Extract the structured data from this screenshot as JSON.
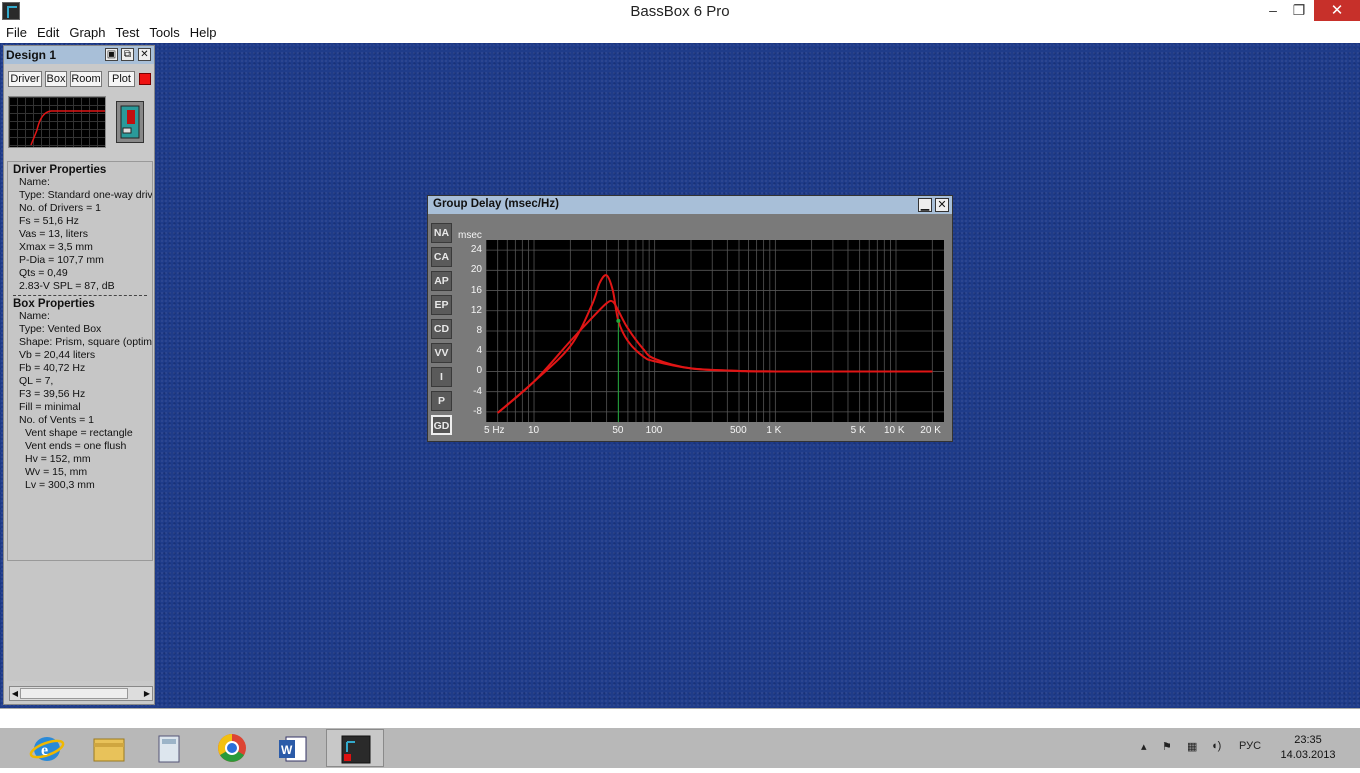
{
  "window": {
    "title": "BassBox 6 Pro",
    "min_label": "–",
    "max_label": "❐",
    "close_label": "✕"
  },
  "menu": [
    "File",
    "Edit",
    "Graph",
    "Test",
    "Tools",
    "Help"
  ],
  "design": {
    "title": "Design 1",
    "tabs": [
      "Driver",
      "Box",
      "Room",
      "Plot"
    ],
    "driver_heading": "Driver Properties",
    "driver_lines": [
      "Name:",
      "Type: Standard one-way driv",
      "No. of Drivers = 1",
      "Fs =  51,6 Hz",
      "Vas =  13, liters",
      "Xmax =  3,5 mm",
      "P-Dia =  107,7 mm",
      "Qts =  0,49",
      "2.83-V SPL =  87, dB"
    ],
    "separator": "------------------------------------------",
    "box_heading": "Box Properties",
    "box_lines": [
      "Name:",
      "Type: Vented Box",
      "Shape: Prism, square (optimu",
      "Vb =  20,44 liters",
      "Fb =  40,72 Hz",
      "QL =  7,",
      "F3 =  39,56 Hz",
      "Fill = minimal",
      "No. of Vents = 1"
    ],
    "vent_lines": [
      "Vent shape = rectangle",
      "Vent ends = one flush",
      "Hv =  152, mm",
      "Wv =  15, mm",
      "Lv =  300,3 mm"
    ]
  },
  "graph": {
    "title": "Group Delay (msec/Hz)",
    "buttons": [
      "NA",
      "CA",
      "AP",
      "EP",
      "CD",
      "VV",
      "I",
      "P",
      "GD"
    ],
    "active_button": "GD",
    "colors": {
      "curve": "#e01515",
      "cursor": "#1fa83a",
      "background": "#000000",
      "grid": "#555555"
    }
  },
  "chart_data": {
    "type": "line",
    "title": "Group Delay (msec/Hz)",
    "ylabel": "msec",
    "xlabel": "",
    "x_scale": "log",
    "xlim": [
      4,
      25000
    ],
    "ylim": [
      -10,
      26
    ],
    "yticks": [
      24,
      20,
      16,
      12,
      8,
      4,
      0,
      -4,
      -8
    ],
    "xtick_labels": [
      "5 Hz",
      "10",
      "50",
      "100",
      "500",
      "1 K",
      "5 K",
      "10 K",
      "20 K"
    ],
    "xtick_values": [
      5,
      10,
      50,
      100,
      500,
      1000,
      5000,
      10000,
      20000
    ],
    "cursor_x": 50,
    "series": [
      {
        "values": [
          [
            5,
            -8.2
          ],
          [
            10,
            -2
          ],
          [
            20,
            5
          ],
          [
            30,
            13
          ],
          [
            35,
            17.5
          ],
          [
            40,
            19
          ],
          [
            45,
            16
          ],
          [
            50,
            10
          ],
          [
            60,
            6
          ],
          [
            80,
            3
          ],
          [
            100,
            2
          ],
          [
            200,
            0.6
          ],
          [
            500,
            0.1
          ],
          [
            1000,
            0
          ],
          [
            20000,
            0
          ]
        ]
      },
      {
        "values": [
          [
            5,
            -8.2
          ],
          [
            10,
            -2
          ],
          [
            20,
            6
          ],
          [
            30,
            10.5
          ],
          [
            40,
            13.5
          ],
          [
            45,
            13.8
          ],
          [
            50,
            12
          ],
          [
            60,
            8.5
          ],
          [
            80,
            4.5
          ],
          [
            100,
            2.5
          ],
          [
            200,
            0.6
          ],
          [
            500,
            0.1
          ],
          [
            1000,
            0
          ],
          [
            20000,
            0
          ]
        ]
      }
    ]
  },
  "taskbar": {
    "lang": "РУС",
    "time": "23:35",
    "date": "14.03.2013"
  }
}
